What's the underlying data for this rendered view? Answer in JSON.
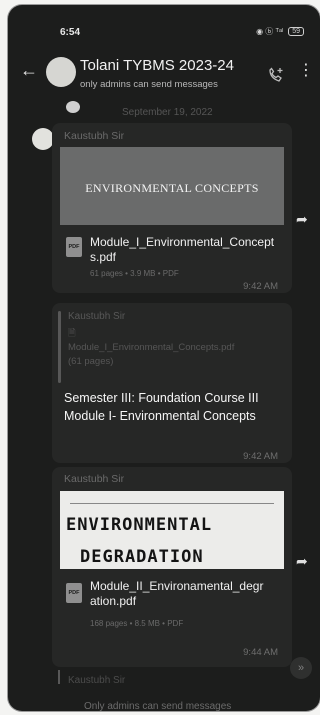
{
  "status_bar": {
    "time": "6:54",
    "icons": "◉ ⓑ ᵀᵃˡ",
    "battery": "59"
  },
  "header": {
    "title": "Tolani TYBMS 2023-24",
    "subtitle": "only admins can send messages"
  },
  "chat": {
    "date_chip": "September 19, 2022",
    "messages": [
      {
        "sender": "Kaustubh Sir",
        "thumbnail_title": "ENVIRONMENTAL CONCEPTS",
        "file_icon": "PDF",
        "file_name": "Module_I_Environmental_Concepts.pdf",
        "file_meta": "61 pages • 3.9 MB • PDF",
        "time": "9:42 AM"
      },
      {
        "quoted_sender": "Kaustubh Sir",
        "quoted_text": "🗎 Module_I_Environmental_Concepts.pdf (61 pages)",
        "text": "Semester III: Foundation Course III Module I- Environmental Concepts",
        "time": "9:42 AM"
      },
      {
        "sender": "Kaustubh Sir",
        "thumbnail_text_line1": "ENVIRONMENTAL",
        "thumbnail_text_line2": "DEGRADATION",
        "file_icon": "PDF",
        "file_name": "Module_II_Environamental_degration.pdf",
        "file_meta": "168 pages • 8.5 MB • PDF",
        "time": "9:44 AM"
      }
    ],
    "footer_sender": "Kaustubh Sir",
    "admin_notice": "Only admins can send messages"
  },
  "icons": {
    "back": "←",
    "menu": "⋮",
    "forward": "➦",
    "scroll_down": "»"
  },
  "colors": {
    "background": "#1c1d1c",
    "bubble": "#262726",
    "text_primary": "#f0f0f0",
    "text_muted": "#6a6a6a"
  }
}
